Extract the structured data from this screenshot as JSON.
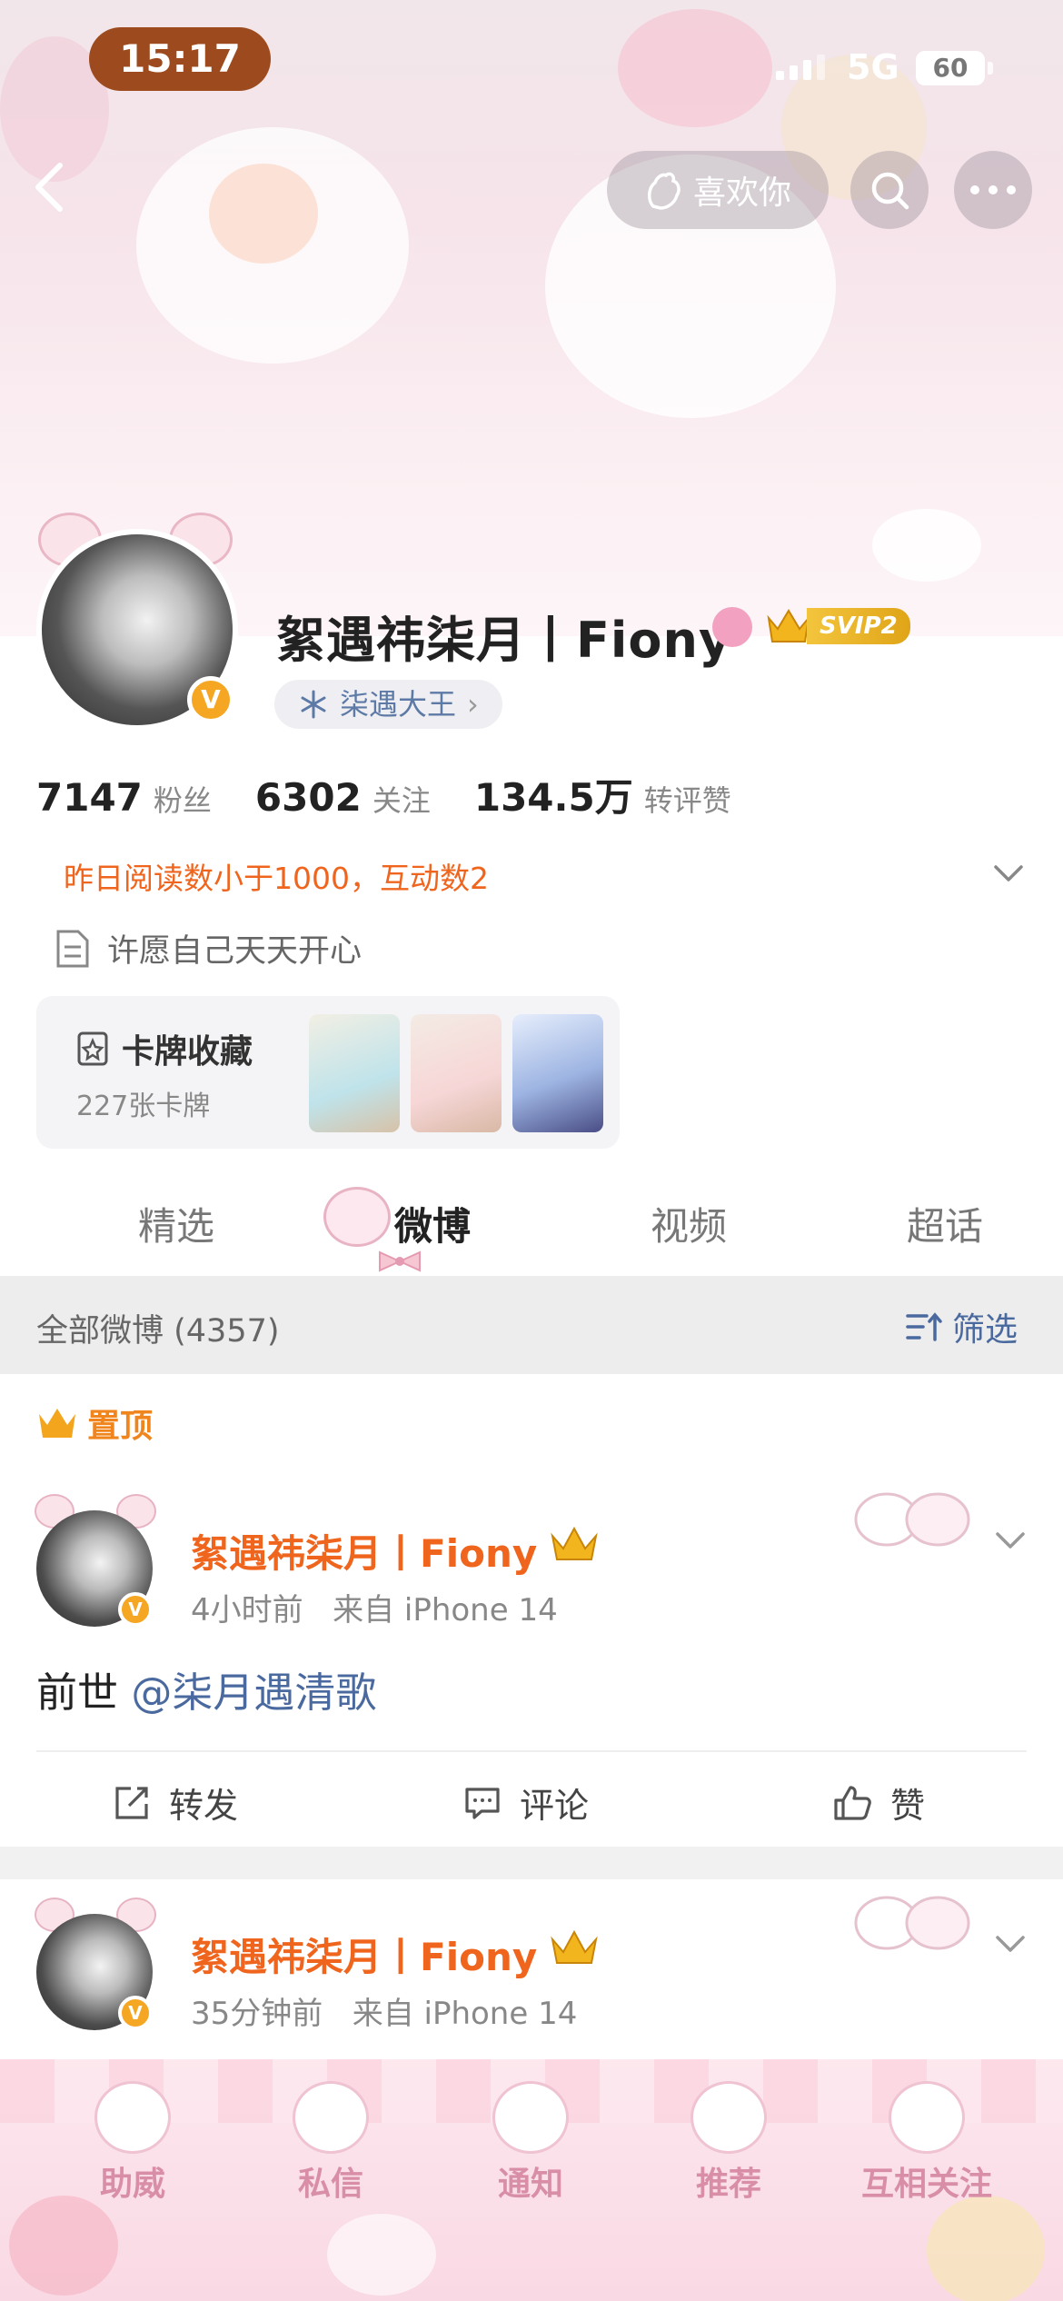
{
  "status_bar": {
    "time": "15:17",
    "network": "5G",
    "battery": "60"
  },
  "top_actions": {
    "like_label": "喜欢你"
  },
  "profile": {
    "name": "絮遇祎柒月丨Fiony",
    "svip": "SVIP2",
    "fan_group": "柒遇大王",
    "stats": [
      {
        "value": "7147",
        "label": "粉丝"
      },
      {
        "value": "6302",
        "label": "关注"
      },
      {
        "value": "134.5万",
        "label": "转评赞"
      }
    ],
    "notice": "昨日阅读数小于1000，互动数2",
    "bio": "许愿自己天天开心",
    "cards": {
      "title": "卡牌收藏",
      "count": "227张卡牌"
    }
  },
  "tabs": [
    "精选",
    "微博",
    "视频",
    "超话"
  ],
  "active_tab": "微博",
  "feed_filter": {
    "label": "全部微博 (4357)",
    "filter_button": "筛选"
  },
  "pinned_label": "置顶",
  "posts": [
    {
      "author": "絮遇祎柒月丨Fiony",
      "time": "4小时前",
      "source": "来自 iPhone 14",
      "text_prefix": "前世",
      "mention": "@柒月遇清歌",
      "actions": {
        "repost": "转发",
        "comment": "评论",
        "like": "赞"
      }
    },
    {
      "author": "絮遇祎柒月丨Fiony",
      "time": "35分钟前",
      "source": "来自 iPhone 14"
    }
  ],
  "bottom_nav": [
    "助威",
    "私信",
    "通知",
    "推荐",
    "互相关注"
  ],
  "colors": {
    "accent_orange": "#f0651e",
    "link_blue": "#4a6a9f",
    "pin_orange": "#f0851e",
    "vip_gold": "#f5a623"
  },
  "icons": [
    "chevron-left-icon",
    "like-hand-icon",
    "search-icon",
    "more-icon",
    "snowflake-icon",
    "document-icon",
    "card-icon",
    "filter-icon",
    "repost-icon",
    "comment-icon",
    "thumbs-up-icon",
    "crown-icon"
  ]
}
